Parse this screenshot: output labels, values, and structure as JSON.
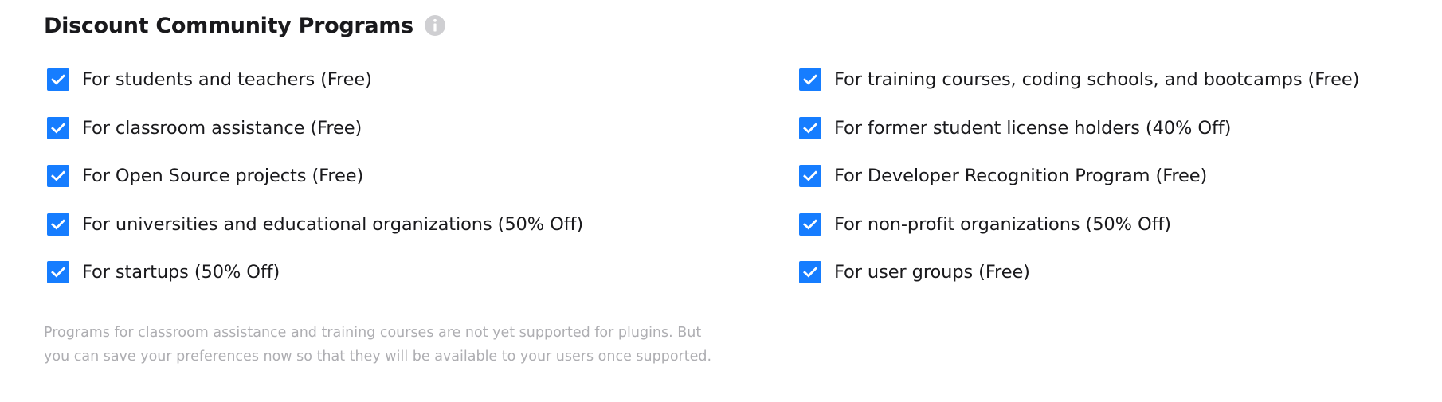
{
  "section": {
    "title": "Discount Community Programs",
    "info_icon": "info-circle-icon"
  },
  "colors": {
    "checkbox": "#167dff",
    "text": "#19191c",
    "muted": "#aeaeb2",
    "info_icon": "#cfcfd2"
  },
  "programs_left": [
    {
      "label": "For students and teachers (Free)",
      "checked": true
    },
    {
      "label": "For classroom assistance (Free)",
      "checked": true
    },
    {
      "label": "For Open Source projects (Free)",
      "checked": true
    },
    {
      "label": "For universities and educational organizations (50% Off)",
      "checked": true
    },
    {
      "label": "For startups (50% Off)",
      "checked": true
    }
  ],
  "programs_right": [
    {
      "label": "For training courses, coding schools, and bootcamps (Free)",
      "checked": true
    },
    {
      "label": "For former student license holders (40% Off)",
      "checked": true
    },
    {
      "label": "For Developer Recognition Program (Free)",
      "checked": true
    },
    {
      "label": "For non-profit organizations (50% Off)",
      "checked": true
    },
    {
      "label": "For user groups (Free)",
      "checked": true
    }
  ],
  "note": {
    "line1": "Programs for classroom assistance and training courses are not yet supported for plugins. But",
    "line2": "you can save your preferences now so that they will be available to your users once supported."
  }
}
